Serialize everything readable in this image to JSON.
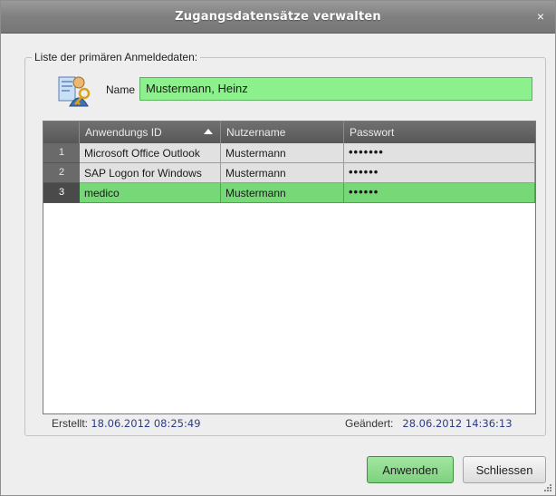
{
  "window": {
    "title": "Zugangsdatensätze verwalten",
    "close_glyph": "×"
  },
  "group": {
    "legend": "Liste der primären Anmeldedaten:"
  },
  "name_field": {
    "label": "Name",
    "value": "Mustermann, Heinz"
  },
  "grid": {
    "columns": [
      "Anwendungs ID",
      "Nutzername",
      "Passwort"
    ],
    "sort": {
      "column": "Anwendungs ID",
      "direction": "ascending"
    },
    "rows": [
      {
        "num": "1",
        "app_id": "Microsoft Office Outlook",
        "user": "Mustermann",
        "password": "•••••••",
        "selected": false
      },
      {
        "num": "2",
        "app_id": "SAP Logon for Windows",
        "user": "Mustermann",
        "password": "••••••",
        "selected": false
      },
      {
        "num": "3",
        "app_id": "medico",
        "user": "Mustermann",
        "password": "••••••",
        "selected": true
      }
    ]
  },
  "meta": {
    "created_label": "Erstellt:",
    "created_value": "18.06.2012 08:25:49",
    "changed_label": "Geändert:",
    "changed_value": "28.06.2012 14:36:13"
  },
  "buttons": {
    "apply": "Anwenden",
    "close": "Schliessen"
  },
  "colors": {
    "accent_green": "#8cf08c",
    "selected_row": "#77d877",
    "titlebar": "#808080"
  },
  "icons": {
    "user_icon": "keys-user-icon",
    "close": "close-icon",
    "sort": "sort-ascending-icon",
    "grip": "resize-grip-icon"
  }
}
